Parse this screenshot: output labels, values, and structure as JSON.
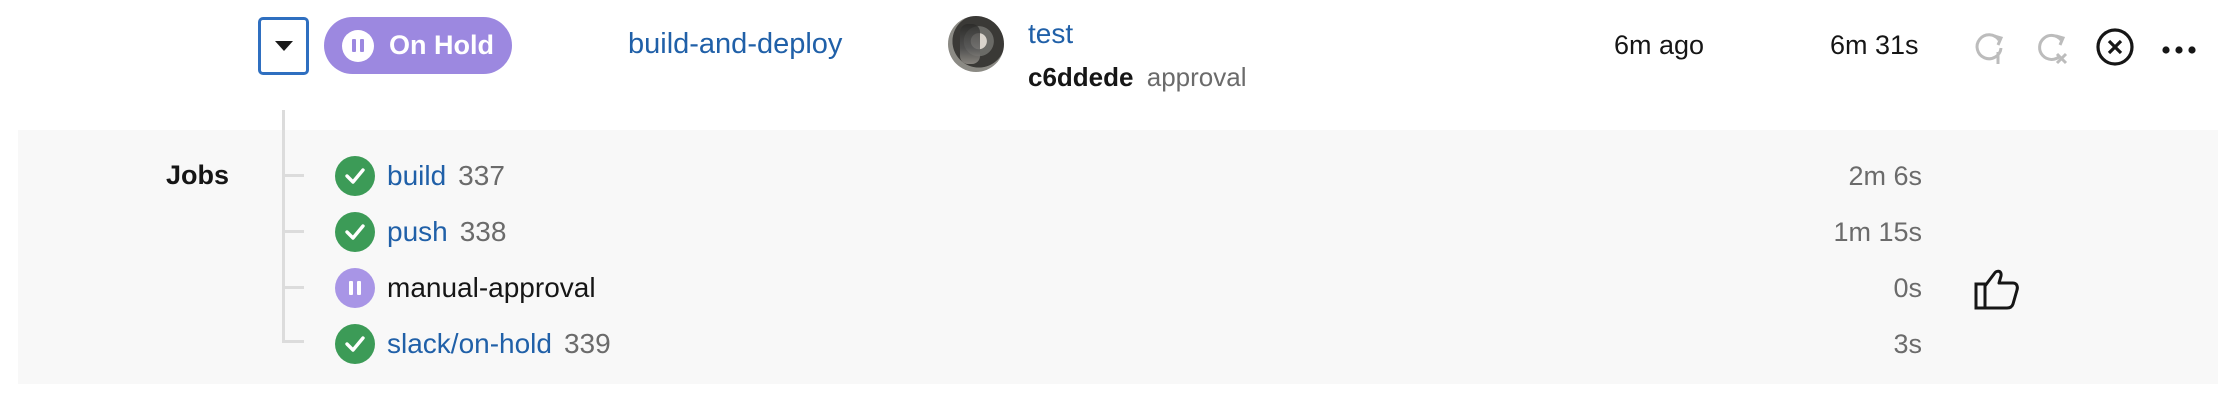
{
  "pipeline": {
    "status_label": "On Hold",
    "workflow_name": "build-and-deploy",
    "user": "test",
    "commit_hash": "c6ddede",
    "commit_message": "approval",
    "time_ago": "6m ago",
    "duration": "6m 31s"
  },
  "actions": {
    "icons": [
      "rerun-icon",
      "rerun-failed-icon",
      "cancel-icon",
      "more-icon"
    ]
  },
  "jobs": {
    "label": "Jobs",
    "items": [
      {
        "name": "build",
        "number": "337",
        "duration": "2m 6s",
        "status": "success"
      },
      {
        "name": "push",
        "number": "338",
        "duration": "1m 15s",
        "status": "success"
      },
      {
        "name": "manual-approval",
        "number": "",
        "duration": "0s",
        "status": "on-hold"
      },
      {
        "name": "slack/on-hold",
        "number": "339",
        "duration": "3s",
        "status": "success"
      }
    ]
  },
  "colors": {
    "on_hold": "#9c88e0",
    "success": "#3c9b57",
    "link": "#2060a8"
  }
}
